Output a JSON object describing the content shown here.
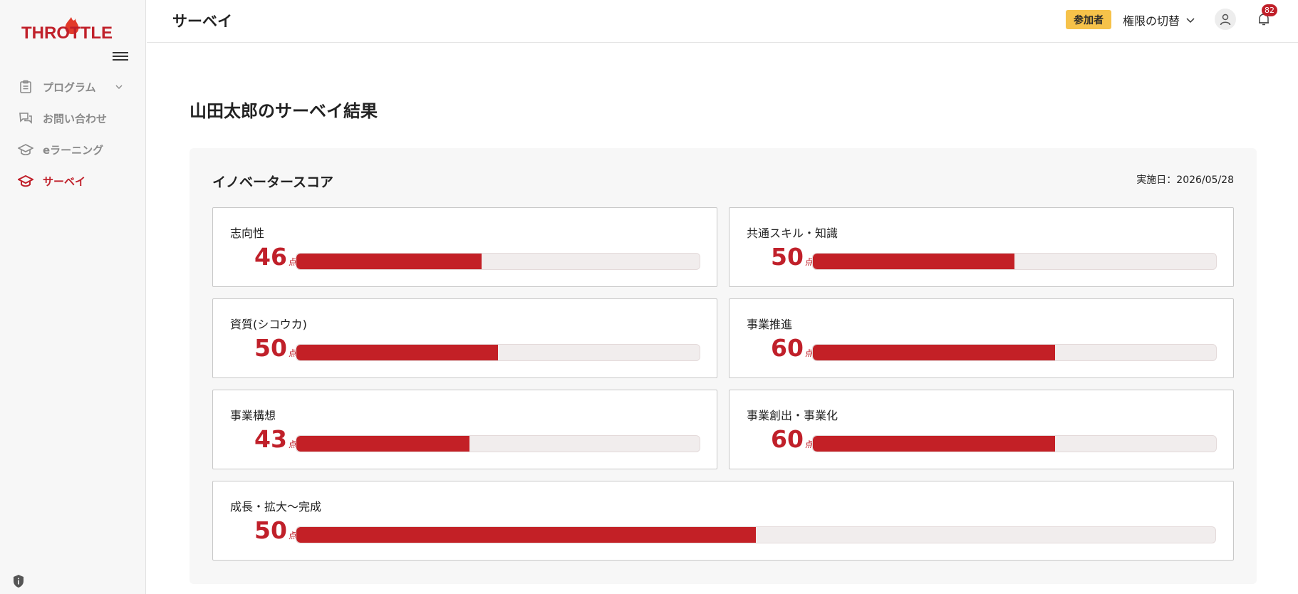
{
  "app": {
    "logo_text": "THROTTLE",
    "accent_color": "#c0202a"
  },
  "sidebar": {
    "items": [
      {
        "label": "プログラム",
        "icon": "clipboard-icon",
        "expandable": true,
        "active": false
      },
      {
        "label": "お問い合わせ",
        "icon": "chat-bubbles-icon",
        "active": false
      },
      {
        "label": "eラーニング",
        "icon": "graduation-cap-icon",
        "active": false
      },
      {
        "label": "サーベイ",
        "icon": "graduation-cap-icon",
        "active": true
      }
    ]
  },
  "header": {
    "title": "サーベイ",
    "role_badge": "参加者",
    "role_switch_label": "権限の切替",
    "notification_count": "82"
  },
  "main": {
    "result_title": "山田太郎のサーベイ結果",
    "panel": {
      "title": "イノベータースコア",
      "date": "実施日：2026/05/28"
    },
    "scores": [
      {
        "label": "志向性",
        "value": "46",
        "unit": "点",
        "percent": 46
      },
      {
        "label": "共通スキル・知識",
        "value": "50",
        "unit": "点",
        "percent": 50
      },
      {
        "label": "資質(シコウカ)",
        "value": "50",
        "unit": "点",
        "percent": 50
      },
      {
        "label": "事業推進",
        "value": "60",
        "unit": "点",
        "percent": 60
      },
      {
        "label": "事業構想",
        "value": "43",
        "unit": "点",
        "percent": 43
      },
      {
        "label": "事業創出・事業化",
        "value": "60",
        "unit": "点",
        "percent": 60
      },
      {
        "label": "成長・拡大〜完成",
        "value": "50",
        "unit": "点",
        "percent": 50
      }
    ]
  }
}
